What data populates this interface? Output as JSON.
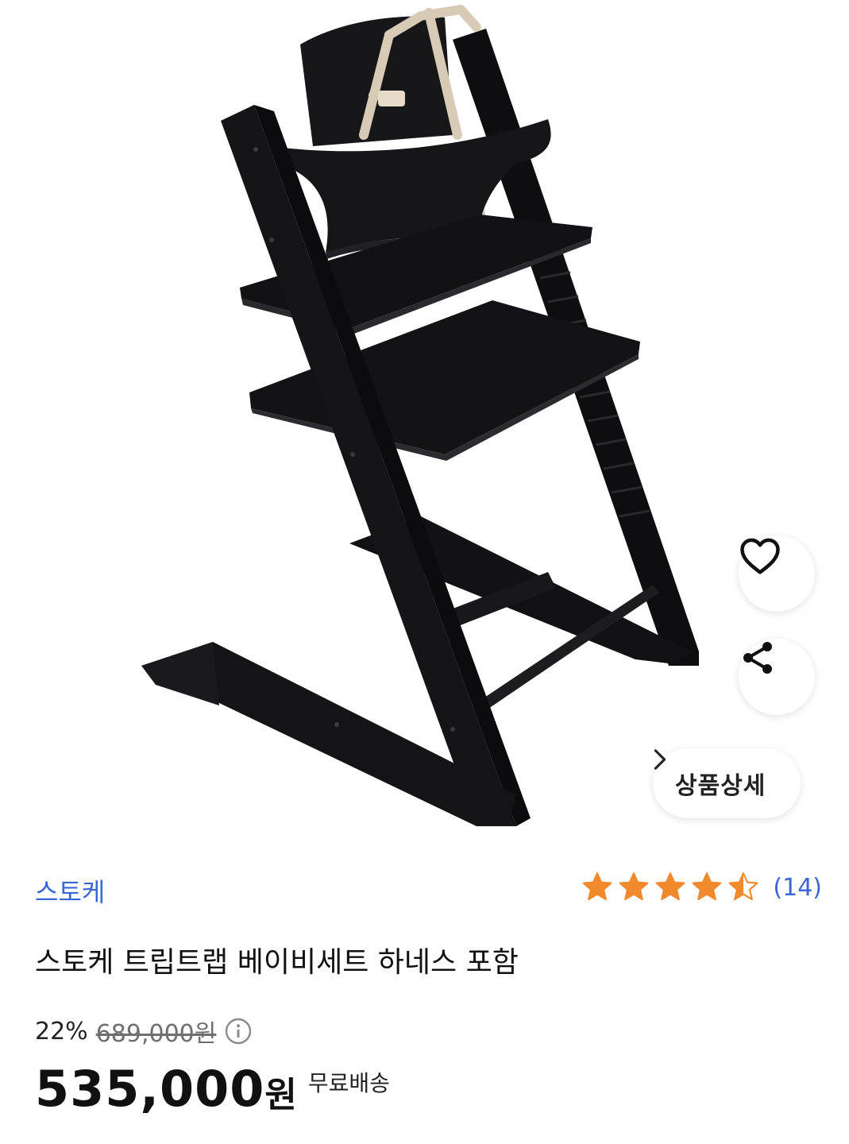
{
  "product": {
    "brand": "스토케",
    "title": "스토케 트립트랩 베이비세트 하네스 포함",
    "rating": {
      "value": 4.5,
      "max": 5,
      "review_count_label": "(14)"
    },
    "price": {
      "discount_label": "22%",
      "original_label": "689,000원",
      "sale_amount": "535,000",
      "sale_currency": "원",
      "shipping_label": "무료배송"
    },
    "detail_button_label": "상품상세"
  },
  "colors": {
    "brand_blue": "#3a66d6",
    "star_orange": "#f08a2c",
    "chair_black": "#141417"
  },
  "icons": {
    "wishlist": "heart-icon",
    "share": "share-icon",
    "detail_arrow": "chevron-right-icon",
    "price_info": "info-icon"
  }
}
